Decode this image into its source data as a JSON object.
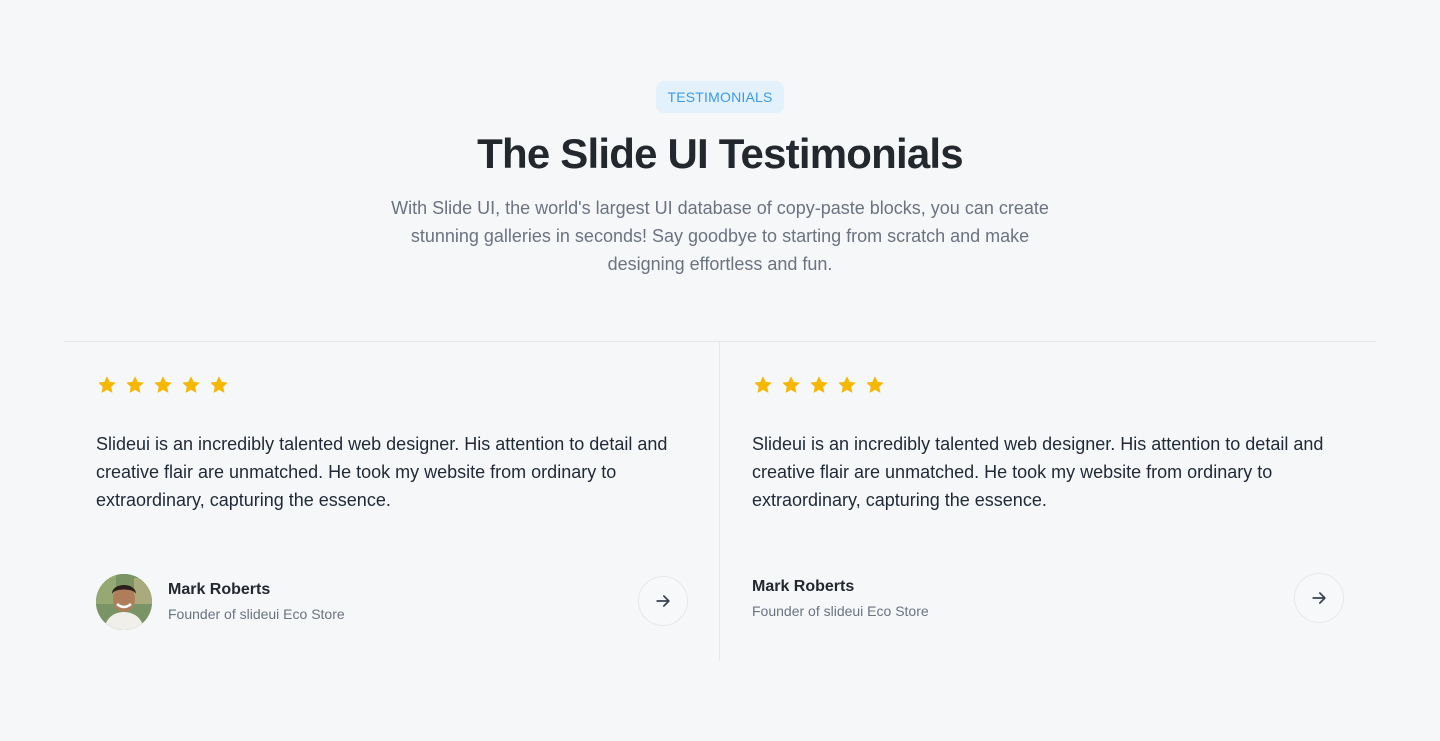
{
  "header": {
    "badge": "TESTIMONIALS",
    "title": "The Slide UI Testimonials",
    "subtitle": "With Slide UI, the world's largest UI database of copy-paste blocks, you can create stunning galleries in seconds! Say goodbye to starting from scratch and make designing effortless and fun."
  },
  "colors": {
    "accent": "#3b9ae8",
    "star": "#f5b700",
    "background": "#f6f7f9"
  },
  "testimonials": [
    {
      "rating": 5,
      "quote": "Slideui is an incredibly talented web designer. His attention to detail and creative flair are unmatched. He took my website from ordinary to extraordinary, capturing the essence.",
      "name": "Mark Roberts",
      "role": "Founder of slideui Eco Store",
      "has_avatar": true
    },
    {
      "rating": 5,
      "quote": "Slideui is an incredibly talented web designer. His attention to detail and creative flair are unmatched. He took my website from ordinary to extraordinary, capturing the essence.",
      "name": "Mark Roberts",
      "role": "Founder of slideui Eco Store",
      "has_avatar": false
    }
  ],
  "icons": {
    "star": "star-icon",
    "next": "arrow-right-icon"
  }
}
